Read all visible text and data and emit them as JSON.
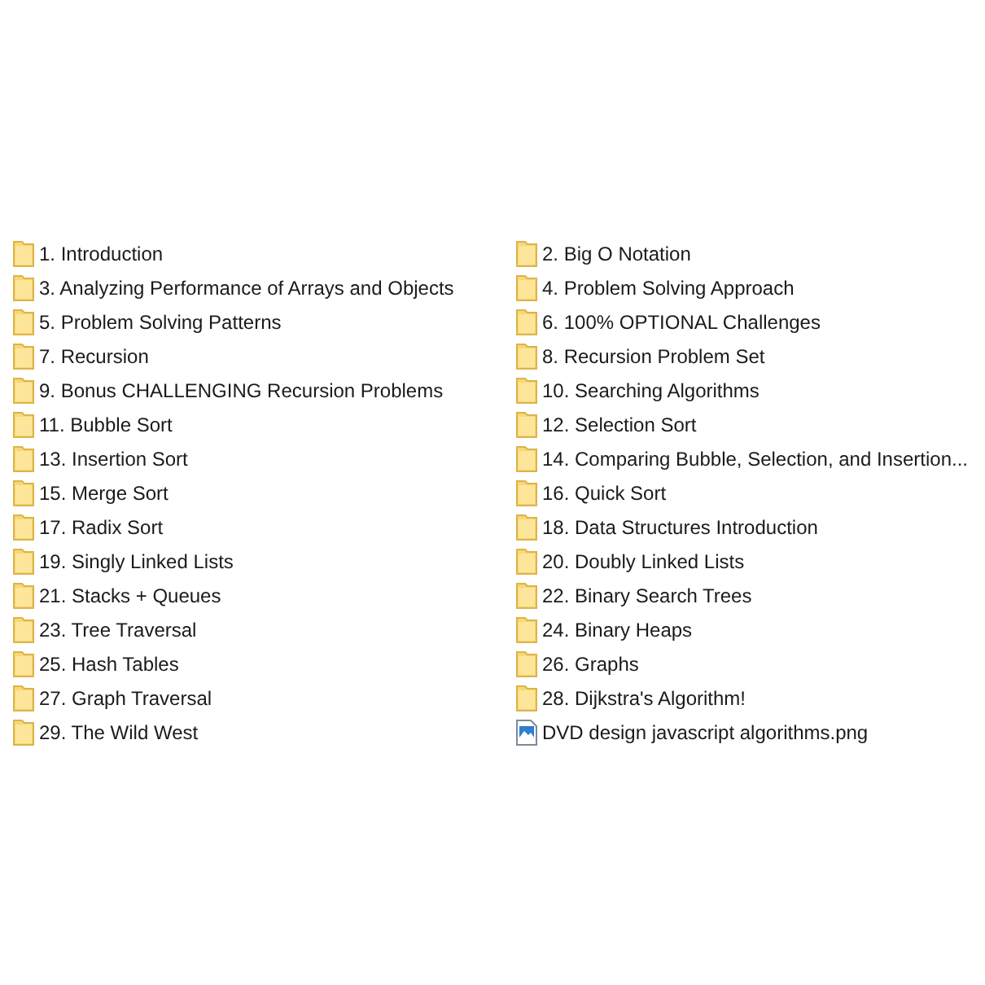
{
  "items": [
    {
      "kind": "folder",
      "label": "1. Introduction"
    },
    {
      "kind": "folder",
      "label": "2. Big O Notation"
    },
    {
      "kind": "folder",
      "label": "3. Analyzing Performance of Arrays and Objects"
    },
    {
      "kind": "folder",
      "label": "4. Problem Solving Approach"
    },
    {
      "kind": "folder",
      "label": "5. Problem Solving Patterns"
    },
    {
      "kind": "folder",
      "label": "6. 100% OPTIONAL Challenges"
    },
    {
      "kind": "folder",
      "label": "7. Recursion"
    },
    {
      "kind": "folder",
      "label": "8. Recursion Problem Set"
    },
    {
      "kind": "folder",
      "label": "9. Bonus CHALLENGING Recursion Problems"
    },
    {
      "kind": "folder",
      "label": "10. Searching Algorithms"
    },
    {
      "kind": "folder",
      "label": "11. Bubble Sort"
    },
    {
      "kind": "folder",
      "label": "12. Selection Sort"
    },
    {
      "kind": "folder",
      "label": "13. Insertion Sort"
    },
    {
      "kind": "folder",
      "label": "14. Comparing Bubble, Selection, and Insertion..."
    },
    {
      "kind": "folder",
      "label": "15. Merge Sort"
    },
    {
      "kind": "folder",
      "label": "16. Quick Sort"
    },
    {
      "kind": "folder",
      "label": "17. Radix Sort"
    },
    {
      "kind": "folder",
      "label": "18. Data Structures Introduction"
    },
    {
      "kind": "folder",
      "label": "19. Singly Linked Lists"
    },
    {
      "kind": "folder",
      "label": "20. Doubly Linked Lists"
    },
    {
      "kind": "folder",
      "label": "21. Stacks + Queues"
    },
    {
      "kind": "folder",
      "label": "22. Binary Search Trees"
    },
    {
      "kind": "folder",
      "label": "23. Tree Traversal"
    },
    {
      "kind": "folder",
      "label": "24. Binary Heaps"
    },
    {
      "kind": "folder",
      "label": "25. Hash Tables"
    },
    {
      "kind": "folder",
      "label": "26. Graphs"
    },
    {
      "kind": "folder",
      "label": "27. Graph Traversal"
    },
    {
      "kind": "folder",
      "label": "28. Dijkstra's Algorithm!"
    },
    {
      "kind": "folder",
      "label": "29. The Wild West"
    },
    {
      "kind": "image",
      "label": "DVD design javascript algorithms.png"
    }
  ]
}
